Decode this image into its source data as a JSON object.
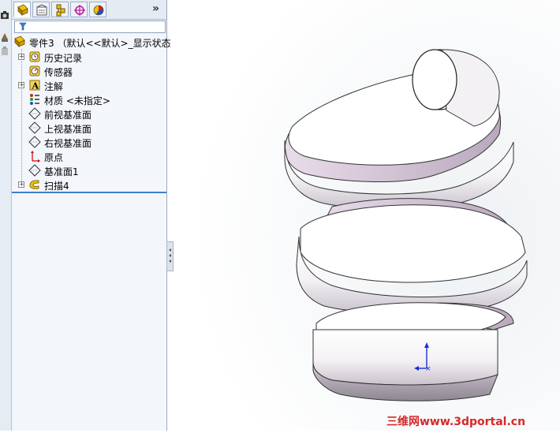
{
  "tabs": {
    "items": [
      {
        "icon": "feature-manager-icon"
      },
      {
        "icon": "property-manager-icon"
      },
      {
        "icon": "configuration-manager-icon"
      },
      {
        "icon": "dimxpert-icon"
      },
      {
        "icon": "display-manager-icon"
      }
    ],
    "more_label": "»"
  },
  "tree": {
    "root_label": "零件3 （默认<<默认>_显示状态",
    "items": [
      {
        "label": "历史记录",
        "icon": "history-icon",
        "expandable": true
      },
      {
        "label": "传感器",
        "icon": "sensor-icon",
        "expandable": false
      },
      {
        "label": "注解",
        "icon": "annotation-icon",
        "expandable": true
      },
      {
        "label": "材质 <未指定>",
        "icon": "material-icon",
        "expandable": false
      },
      {
        "label": "前视基准面",
        "icon": "plane-icon",
        "expandable": false
      },
      {
        "label": "上视基准面",
        "icon": "plane-icon",
        "expandable": false
      },
      {
        "label": "右视基准面",
        "icon": "plane-icon",
        "expandable": false
      },
      {
        "label": "原点",
        "icon": "origin-icon",
        "expandable": false
      },
      {
        "label": "基准面1",
        "icon": "plane-icon",
        "expandable": false
      },
      {
        "label": "扫描4",
        "icon": "sweep-icon",
        "expandable": true
      }
    ]
  },
  "watermark": "三维网www.3dportal.cn",
  "colors": {
    "accent": "#3f7ecb",
    "watermark": "#d4282a"
  }
}
